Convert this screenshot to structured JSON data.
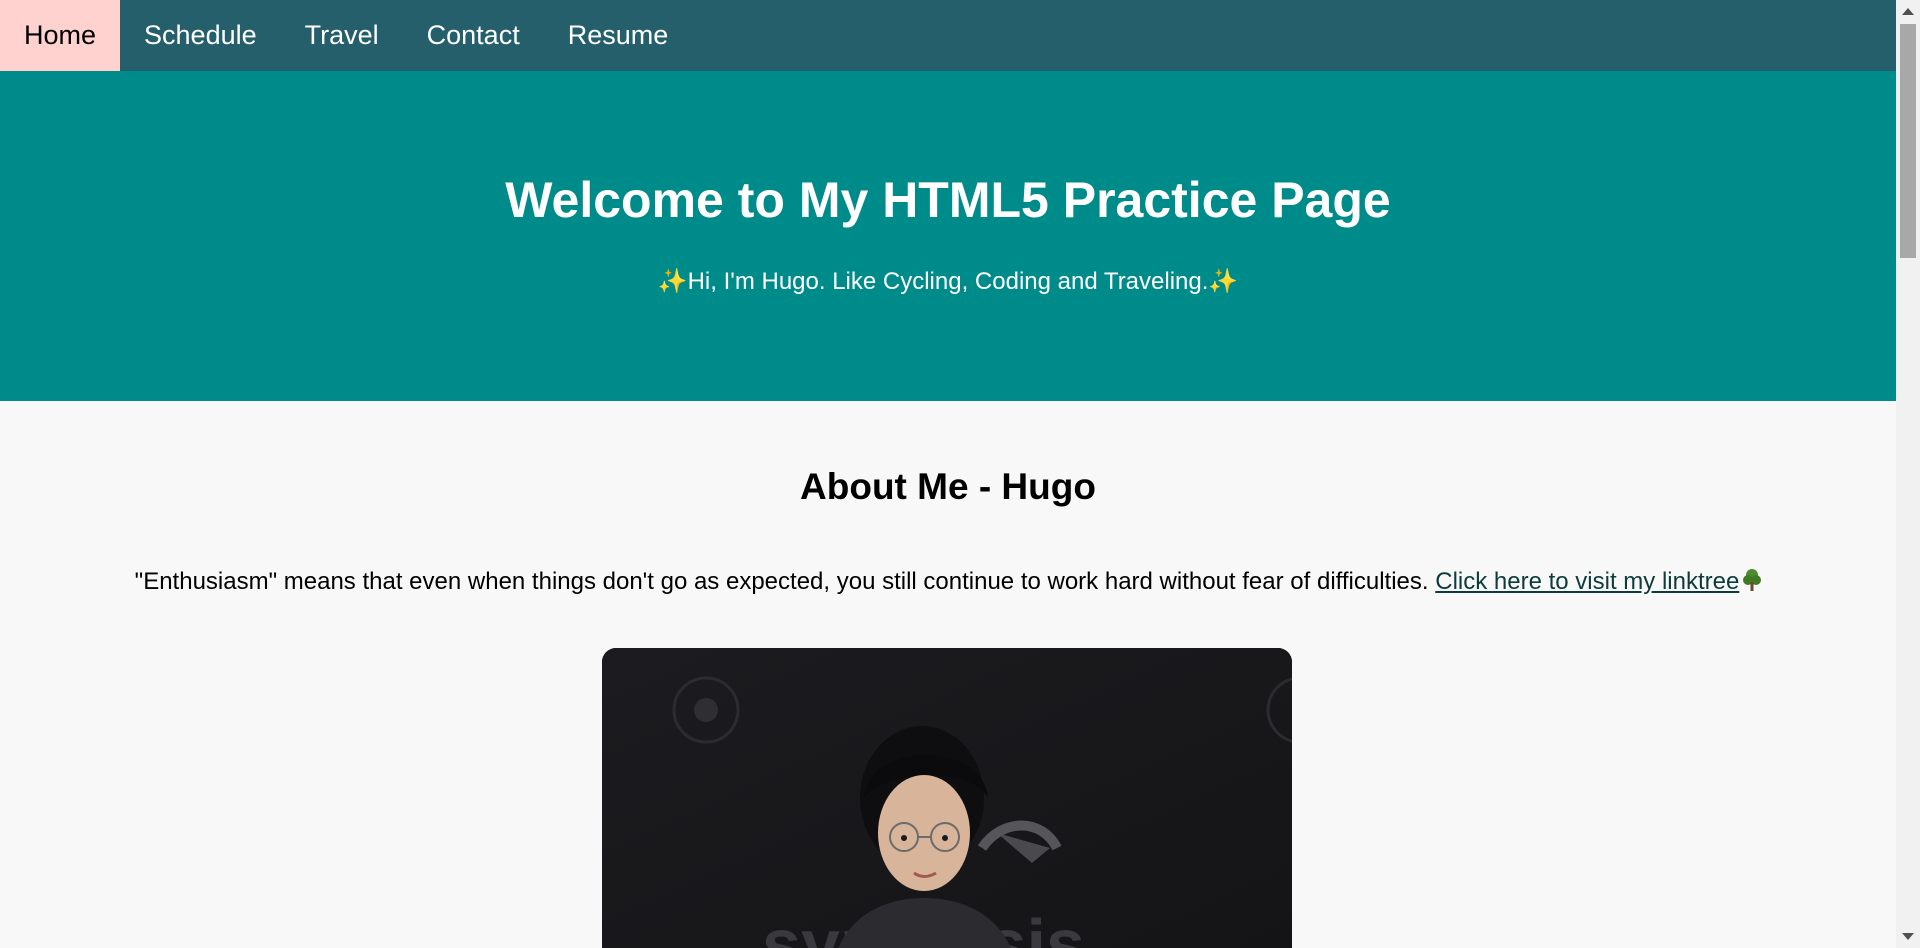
{
  "nav": {
    "items": [
      {
        "label": "Home",
        "active": true
      },
      {
        "label": "Schedule",
        "active": false
      },
      {
        "label": "Travel",
        "active": false
      },
      {
        "label": "Contact",
        "active": false
      },
      {
        "label": "Resume",
        "active": false
      }
    ]
  },
  "hero": {
    "title": "Welcome to My HTML5 Practice Page",
    "subtitle_prefix": "✨",
    "subtitle": "Hi, I'm Hugo. Like Cycling, Coding and Traveling.",
    "subtitle_suffix": "✨"
  },
  "about": {
    "title": "About Me - Hugo",
    "text": "\"Enthusiasm\" means that even when things don't go as expected, you still continue to work hard without fear of difficulties. ",
    "link_label": "Click here to visit my linktree",
    "link_icon": "tree-icon"
  },
  "colors": {
    "nav_bg": "#245f6b",
    "nav_active_bg": "#ffd2cf",
    "hero_bg": "#008b8b",
    "page_bg": "#f8f8f8"
  }
}
